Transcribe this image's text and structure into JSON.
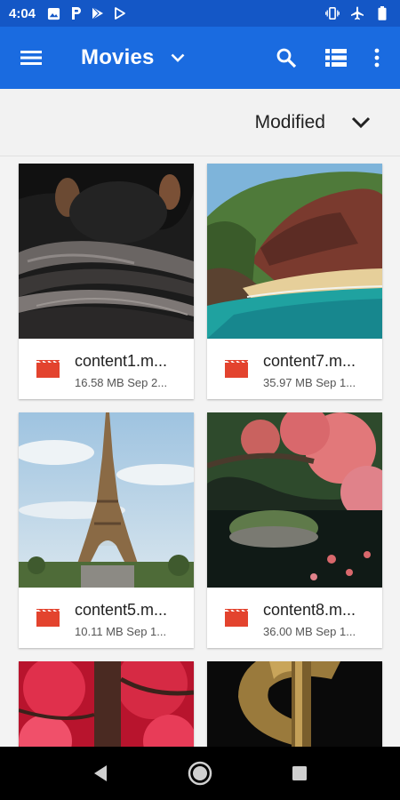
{
  "status_bar": {
    "time": "4:04",
    "left_icons": [
      "image-icon",
      "parking-icon",
      "play-store-icon",
      "play-outline-icon"
    ],
    "right_icons": [
      "vibrate-icon",
      "airplane-icon",
      "battery-icon"
    ]
  },
  "app_bar": {
    "title": "Movies",
    "icons": [
      "menu-icon",
      "chevron-down-icon",
      "search-icon",
      "list-view-icon",
      "more-vert-icon"
    ]
  },
  "sort_bar": {
    "label": "Modified"
  },
  "files": [
    {
      "name": "content1.m...",
      "meta": "16.58 MB Sep 2..."
    },
    {
      "name": "content7.m...",
      "meta": "35.97 MB Sep 1..."
    },
    {
      "name": "content5.m...",
      "meta": "10.11 MB Sep 1..."
    },
    {
      "name": "content8.m...",
      "meta": "36.00 MB Sep 1..."
    }
  ],
  "colors": {
    "status_bar": "#1457c6",
    "app_bar": "#1a6be0",
    "video_icon": "#e3432e"
  },
  "nav_bar": {
    "icons": [
      "back-icon",
      "home-icon",
      "recents-icon"
    ]
  }
}
